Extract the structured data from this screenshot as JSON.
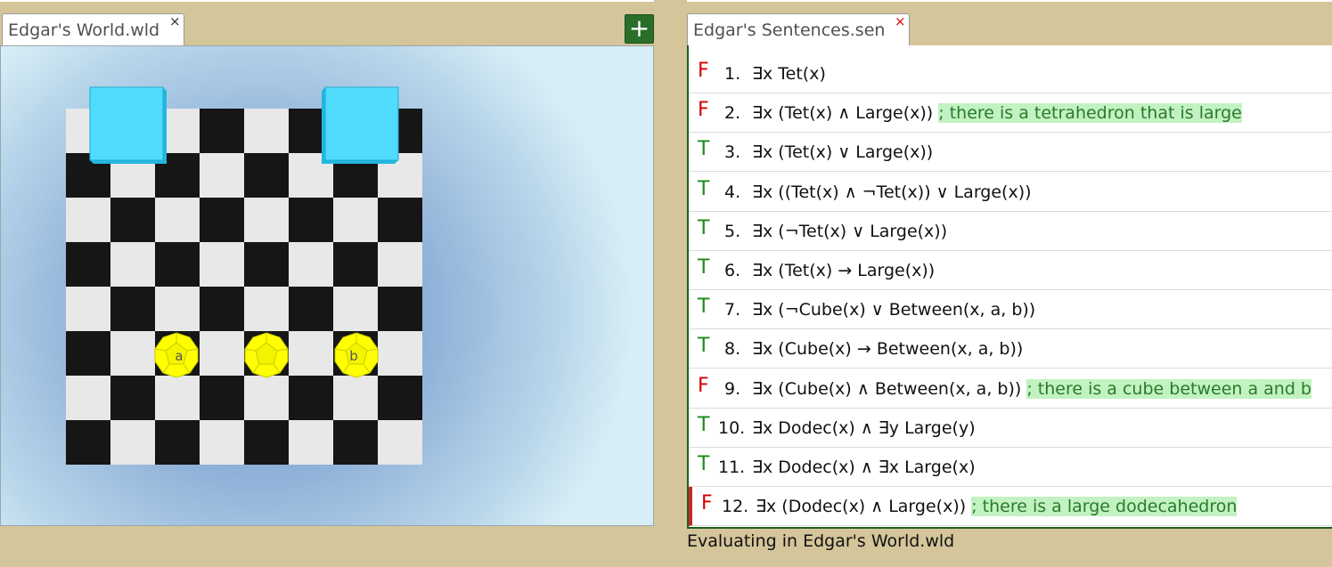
{
  "world_tab": {
    "label": "Edgar's World.wld",
    "close": "×"
  },
  "add_button": {
    "label": "+"
  },
  "sentences_tab": {
    "label": "Edgar's Sentences.sen",
    "close": "×"
  },
  "world": {
    "blocks": [
      {
        "shape": "cube",
        "size": "large",
        "color": "#4fdcff",
        "label": ""
      },
      {
        "shape": "cube",
        "size": "large",
        "color": "#4fdcff",
        "label": ""
      },
      {
        "shape": "dodec",
        "size": "small",
        "color": "#ffff00",
        "label": "a"
      },
      {
        "shape": "dodec",
        "size": "small",
        "color": "#ffff00",
        "label": ""
      },
      {
        "shape": "dodec",
        "size": "small",
        "color": "#ffff00",
        "label": "b"
      }
    ]
  },
  "sentences": [
    {
      "truth": "F",
      "num": "1.",
      "formula": "∃x Tet(x)",
      "comment": ""
    },
    {
      "truth": "F",
      "num": "2.",
      "formula": "∃x (Tet(x) ∧ Large(x))",
      "comment": "; there is a tetrahedron that is large"
    },
    {
      "truth": "T",
      "num": "3.",
      "formula": "∃x (Tet(x) ∨ Large(x))",
      "comment": ""
    },
    {
      "truth": "T",
      "num": "4.",
      "formula": "∃x ((Tet(x) ∧ ¬Tet(x)) ∨ Large(x))",
      "comment": ""
    },
    {
      "truth": "T",
      "num": "5.",
      "formula": "∃x (¬Tet(x) ∨ Large(x))",
      "comment": ""
    },
    {
      "truth": "T",
      "num": "6.",
      "formula": "∃x (Tet(x) → Large(x))",
      "comment": ""
    },
    {
      "truth": "T",
      "num": "7.",
      "formula": "∃x (¬Cube(x) ∨ Between(x, a, b))",
      "comment": ""
    },
    {
      "truth": "T",
      "num": "8.",
      "formula": "∃x (Cube(x) → Between(x, a, b))",
      "comment": ""
    },
    {
      "truth": "F",
      "num": "9.",
      "formula": "∃x (Cube(x) ∧ Between(x, a, b))",
      "comment": "; there is a cube between a and b"
    },
    {
      "truth": "T",
      "num": "10.",
      "formula": "∃x Dodec(x) ∧ ∃y Large(y)",
      "comment": ""
    },
    {
      "truth": "T",
      "num": "11.",
      "formula": "∃x Dodec(x) ∧ ∃x Large(x)",
      "comment": ""
    },
    {
      "truth": "F",
      "num": "12.",
      "formula": "∃x (Dodec(x) ∧ Large(x))",
      "comment": "; there is a large dodecahedron"
    }
  ],
  "status": {
    "text": "Evaluating in Edgar's World.wld"
  },
  "colors": {
    "true": "#1a8a1a",
    "false": "#d40000",
    "comment_bg": "#c2f2c2",
    "accent": "#2a6e2a"
  }
}
